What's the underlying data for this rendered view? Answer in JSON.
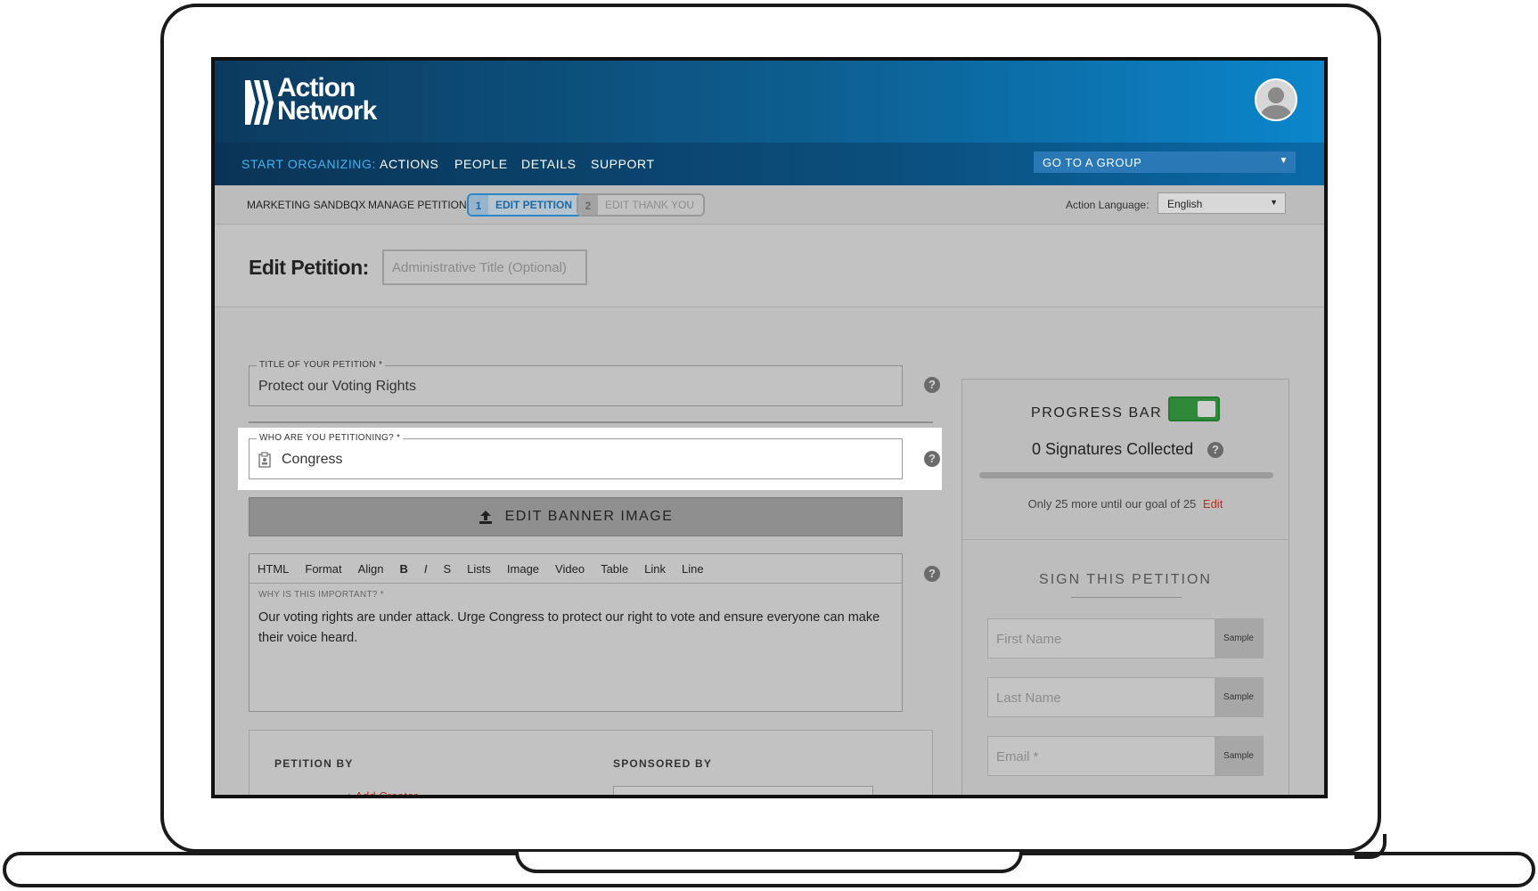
{
  "header": {
    "logo_line1": "Action",
    "logo_line2": "Network"
  },
  "nav": {
    "start_label": "START ORGANIZING:",
    "items": [
      "ACTIONS",
      "PEOPLE",
      "DETAILS",
      "SUPPORT"
    ],
    "group_select": "GO TO A GROUP"
  },
  "subbar": {
    "crumb1": "MARKETING SANDBOX",
    "separator": "|",
    "crumb2": "MANAGE PETITION",
    "step1_num": "1",
    "step1_label": "EDIT PETITION",
    "step2_num": "2",
    "step2_label": "EDIT THANK YOU",
    "lang_label": "Action Language:",
    "lang_value": "English"
  },
  "title_area": {
    "label": "Edit Petition:",
    "admin_placeholder": "Administrative Title (Optional)"
  },
  "form": {
    "title_legend": "TITLE OF YOUR PETITION *",
    "title_value": "Protect our Voting Rights",
    "target_legend": "WHO ARE YOU PETITIONING? *",
    "target_value": "Congress",
    "banner_button": "EDIT BANNER IMAGE",
    "toolbar": [
      "HTML",
      "Format",
      "Align",
      "B",
      "I",
      "S",
      "Lists",
      "Image",
      "Video",
      "Table",
      "Link",
      "Line"
    ],
    "why_legend": "WHY IS THIS IMPORTANT? *",
    "why_text": "Our voting rights are under attack. Urge Congress to protect our right to vote and ensure everyone can make their voice heard.",
    "petition_by": "PETITION BY",
    "sponsored_by": "SPONSORED BY",
    "add_creator": "+ Add Creator",
    "help_glyph": "?"
  },
  "panel": {
    "progress_label": "PROGRESS BAR",
    "progress_enabled": true,
    "signatures": "0 Signatures Collected",
    "progress_fraction": 0,
    "goal_text": "Only 25 more until our goal of 25",
    "goal_edit": "Edit",
    "sign_title": "SIGN THIS PETITION",
    "fields": [
      {
        "placeholder": "First Name",
        "sample": "Sample"
      },
      {
        "placeholder": "Last Name",
        "sample": "Sample"
      },
      {
        "placeholder": "Email *",
        "sample": "Sample"
      }
    ]
  },
  "colors": {
    "header_dark": "#0c3a5e",
    "header_light": "#0b86cc",
    "start_link": "#43b1f0",
    "toggle_on": "#2e8a38",
    "link_red": "#b3321e"
  }
}
